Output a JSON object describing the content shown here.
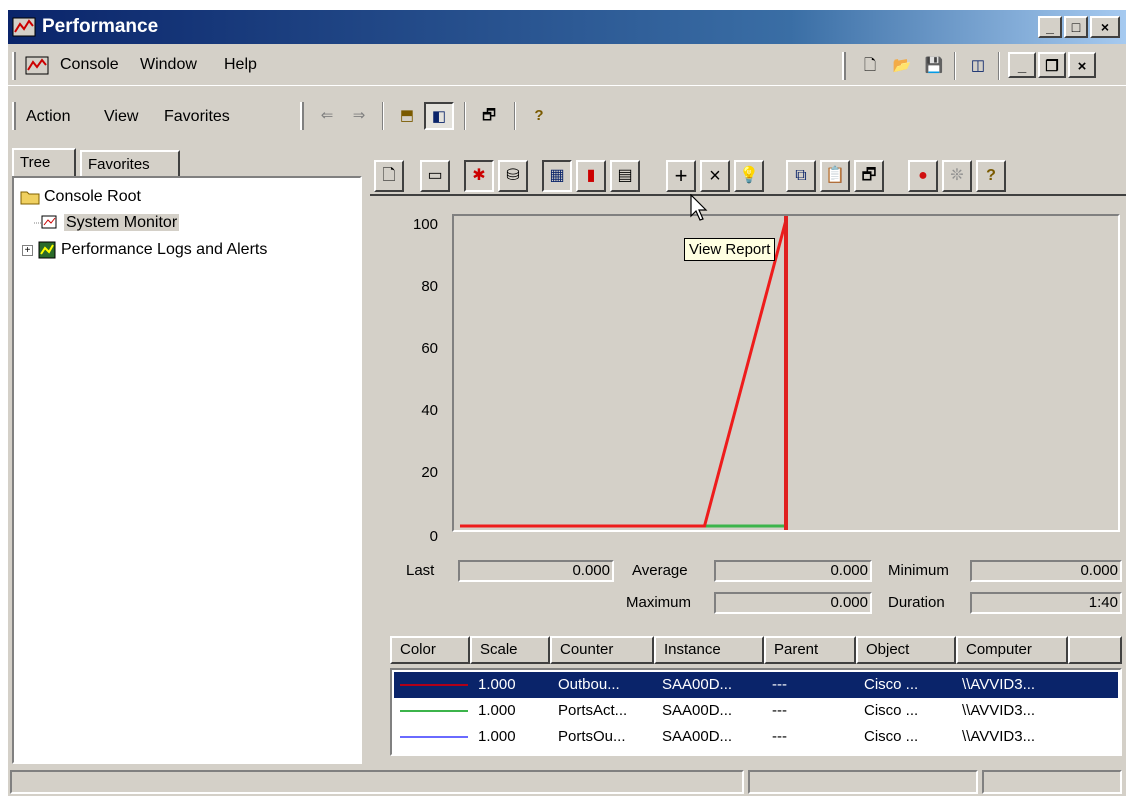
{
  "window": {
    "title": "Performance"
  },
  "menu": {
    "console": "Console",
    "window": "Window",
    "help": "Help"
  },
  "actionbar": {
    "action": "Action",
    "view": "View",
    "favorites": "Favorites"
  },
  "tabs": {
    "tree": "Tree",
    "favorites": "Favorites"
  },
  "tree": {
    "root": "Console Root",
    "system_monitor": "System Monitor",
    "logs": "Performance Logs and Alerts"
  },
  "tooltip": "View Report",
  "chart_data": {
    "type": "line",
    "ylim": [
      0,
      100
    ],
    "yticks": [
      "100",
      "80",
      "60",
      "40",
      "20",
      "0"
    ],
    "series": [
      {
        "color": "#ee1c1c",
        "values": [
          0,
          0,
          0,
          0,
          100
        ]
      },
      {
        "color": "#3cb44b",
        "values": [
          0,
          0,
          0,
          0,
          0
        ]
      },
      {
        "color": "#6a6aff",
        "values": [
          0,
          0,
          0,
          0,
          0
        ]
      }
    ],
    "time_bar_fraction": 0.5
  },
  "stats": {
    "last_label": "Last",
    "last_value": "0.000",
    "average_label": "Average",
    "average_value": "0.000",
    "minimum_label": "Minimum",
    "minimum_value": "0.000",
    "maximum_label": "Maximum",
    "maximum_value": "0.000",
    "duration_label": "Duration",
    "duration_value": "1:40"
  },
  "legend": {
    "headers": [
      "Color",
      "Scale",
      "Counter",
      "Instance",
      "Parent",
      "Object",
      "Computer"
    ],
    "rows": [
      {
        "color": "#b00018",
        "scale": "1.000",
        "counter": "Outbou...",
        "instance": "SAA00D...",
        "parent": "---",
        "object": "Cisco ...",
        "computer": "\\\\AVVID3..."
      },
      {
        "color": "#3cb44b",
        "scale": "1.000",
        "counter": "PortsAct...",
        "instance": "SAA00D...",
        "parent": "---",
        "object": "Cisco ...",
        "computer": "\\\\AVVID3..."
      },
      {
        "color": "#6a6aff",
        "scale": "1.000",
        "counter": "PortsOu...",
        "instance": "SAA00D...",
        "parent": "---",
        "object": "Cisco ...",
        "computer": "\\\\AVVID3..."
      }
    ]
  }
}
